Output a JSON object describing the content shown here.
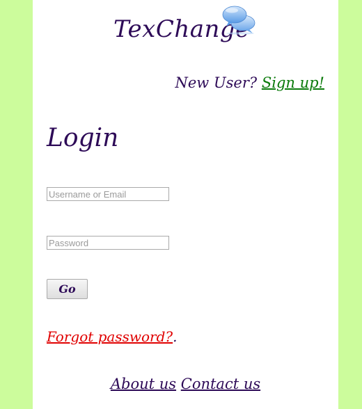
{
  "header": {
    "logo_text": "TexChange",
    "logo_icon": "speech-bubbles-icon"
  },
  "signup": {
    "prompt": "New User?",
    "link_label": "Sign up!"
  },
  "login": {
    "heading": "Login",
    "username_placeholder": "Username or Email",
    "username_value": "",
    "password_placeholder": "Password",
    "password_value": "",
    "submit_label": "Go"
  },
  "forgot": {
    "link_label": "Forgot password?",
    "trailing": "."
  },
  "footer": {
    "about_label": "About us",
    "contact_label": "Contact us"
  },
  "colors": {
    "background": "#ccfc9c",
    "text": "#2d0a57",
    "signup_link": "#0a7a0a",
    "forgot_link": "#e00000"
  }
}
